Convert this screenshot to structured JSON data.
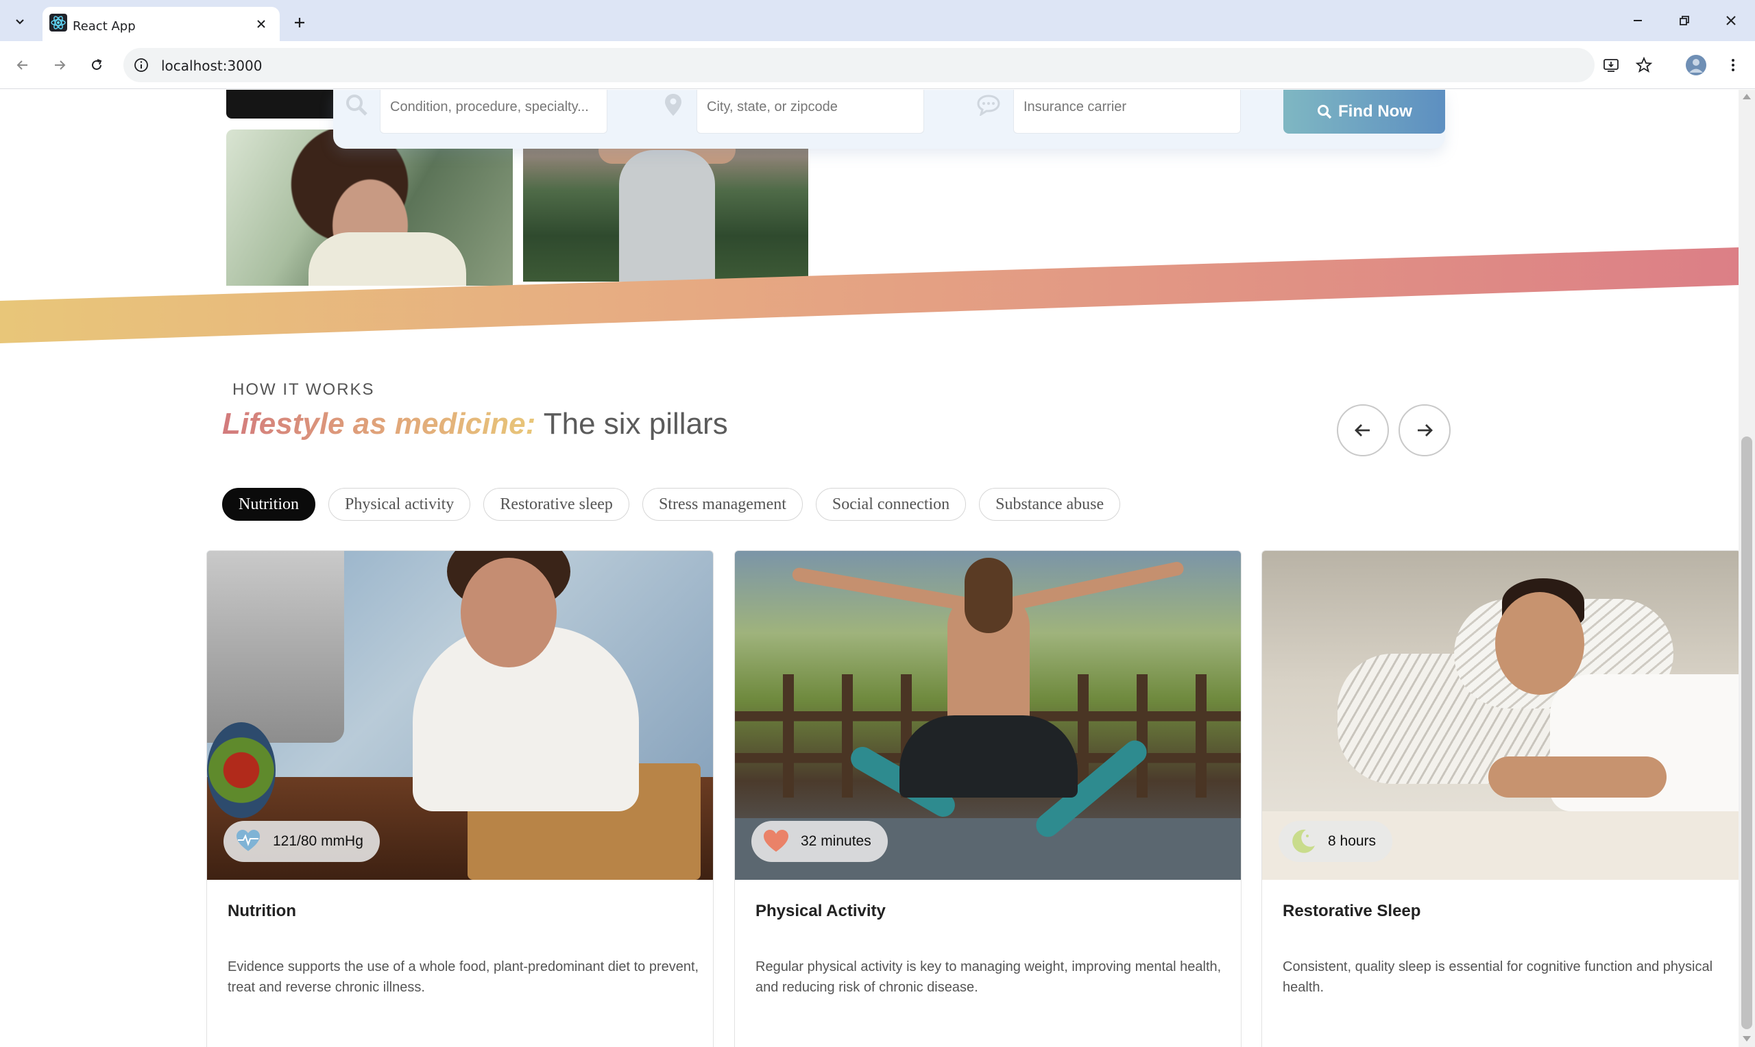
{
  "browser": {
    "tab_title": "React App",
    "url": "localhost:3000"
  },
  "search": {
    "condition_placeholder": "Condition, procedure, specialty...",
    "location_placeholder": "City, state, or zipcode",
    "insurance_placeholder": "Insurance carrier",
    "find_label": "Find Now"
  },
  "section": {
    "eyebrow": "HOW IT WORKS",
    "title_accent": "Lifestyle as medicine:",
    "title_rest": " The six pillars"
  },
  "chips": [
    {
      "label": "Nutrition",
      "active": true
    },
    {
      "label": "Physical activity",
      "active": false
    },
    {
      "label": "Restorative sleep",
      "active": false
    },
    {
      "label": "Stress management",
      "active": false
    },
    {
      "label": "Social connection",
      "active": false
    },
    {
      "label": "Substance abuse",
      "active": false
    }
  ],
  "cards": [
    {
      "metric": "121/80 mmHg",
      "metric_icon": "heart-pulse-icon",
      "title": "Nutrition",
      "text": "Evidence supports the use of a whole food, plant-predominant diet to prevent, treat and reverse chronic illness."
    },
    {
      "metric": "32 minutes",
      "metric_icon": "heart-icon",
      "title": "Physical Activity",
      "text": "Regular physical activity is key to managing weight, improving mental health, and reducing risk of chronic disease."
    },
    {
      "metric": "8 hours",
      "metric_icon": "moon-icon",
      "title": "Restorative Sleep",
      "text": "Consistent, quality sleep is essential for cognitive function and physical health."
    }
  ],
  "colors": {
    "band_start": "#e8c679",
    "band_end": "#dc7f86",
    "accent_start": "#d27a7c",
    "accent_end": "#e8c679",
    "find_button_start": "#7fb7c2",
    "find_button_end": "#5d8fc1"
  }
}
